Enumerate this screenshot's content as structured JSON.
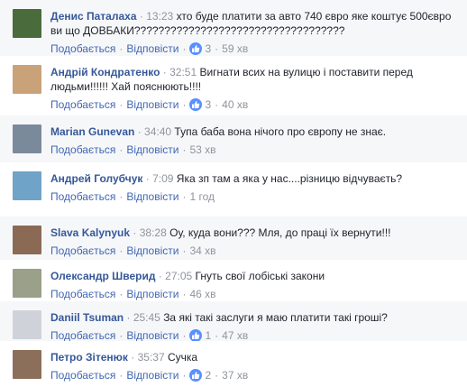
{
  "labels": {
    "like": "Подобається",
    "reply": "Відповісти",
    "dot": "·"
  },
  "comments": [
    {
      "author": "Денис Паталаха",
      "ts": "13:23",
      "text": "хто буде платити за авто 740 євро яке коштує 500євро ви що ДОВБАКИ???????????????????????????????????",
      "likes": "3",
      "age": "59 хв",
      "avatar_color": "#4a6b3c"
    },
    {
      "author": "Андрій Кондратенко",
      "ts": "32:51",
      "text": "Вигнати всих на вулицю і поставити перед людьми!!!!!! Хай пояснюють!!!!",
      "likes": "3",
      "age": "40 хв",
      "avatar_color": "#c9a27a"
    },
    {
      "author": "Marian Gunevan",
      "ts": "34:40",
      "text": "Тупа баба вона нічого про європу не знає.",
      "likes": "",
      "age": "53 хв",
      "avatar_color": "#7a8a9a"
    },
    {
      "author": "Андрей Голубчук",
      "ts": "7:09",
      "text": "Яка зп там а яка у нас....різницю відчуваєть?",
      "likes": "",
      "age": "1 год",
      "avatar_color": "#6fa3c7"
    },
    {
      "author": "Slava Kalynyuk",
      "ts": "38:28",
      "text": "Оу, куда вони??? Мля, до праці їх вернути!!!",
      "likes": "",
      "age": "34 хв",
      "avatar_color": "#8b6a55"
    },
    {
      "author": "Олександр Шверид",
      "ts": "27:05",
      "text": "Гнуть свої лобіські закони",
      "likes": "",
      "age": "46 хв",
      "avatar_color": "#9aa089"
    },
    {
      "author": "Daniil Tsuman",
      "ts": "25:45",
      "text": "За які такі заслуги я маю платити такі гроші?",
      "likes": "1",
      "age": "47 хв",
      "avatar_color": "#cfd3d9"
    },
    {
      "author": "Петро Зітенюк",
      "ts": "35:37",
      "text": "Сучка",
      "likes": "2",
      "age": "37 хв",
      "avatar_color": "#8c6f5a"
    }
  ]
}
